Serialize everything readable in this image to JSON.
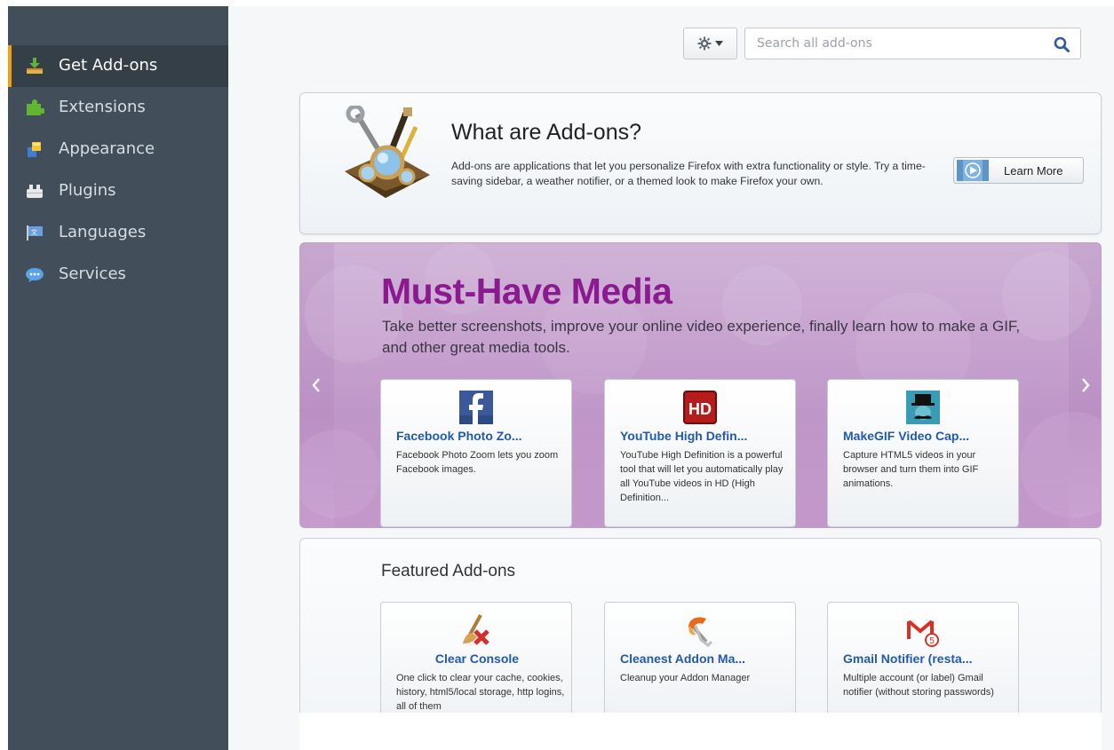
{
  "sidebar": {
    "items": [
      {
        "label": "Get Add-ons",
        "icon": "get-addons-icon",
        "selected": true
      },
      {
        "label": "Extensions",
        "icon": "puzzle-icon",
        "selected": false
      },
      {
        "label": "Appearance",
        "icon": "appearance-icon",
        "selected": false
      },
      {
        "label": "Plugins",
        "icon": "plugin-icon",
        "selected": false
      },
      {
        "label": "Languages",
        "icon": "languages-icon",
        "selected": false
      },
      {
        "label": "Services",
        "icon": "services-icon",
        "selected": false
      }
    ]
  },
  "toolbar": {
    "gear_icon": "gear-icon",
    "search": {
      "placeholder": "Search all add-ons",
      "value": ""
    }
  },
  "about": {
    "title": "What are Add-ons?",
    "description": "Add-ons are applications that let you personalize Firefox with extra functionality or style. Try a time-saving sidebar, a weather notifier, or a themed look to make Firefox your own.",
    "learn_more_label": "Learn More"
  },
  "media": {
    "title": "Must-Have Media",
    "description": "Take better screenshots, improve your online video experience, finally learn how to make a GIF, and other great media tools.",
    "cards": [
      {
        "name": "Facebook Photo Zo...",
        "description": "Facebook Photo Zoom lets you zoom Facebook images.",
        "icon": "facebook-icon"
      },
      {
        "name": "YouTube High Defin...",
        "description": "YouTube High Definition is a powerful tool that will let you automatically play all YouTube videos in HD (High Definition...",
        "icon": "hd-icon"
      },
      {
        "name": "MakeGIF Video Cap...",
        "description": "Capture HTML5 videos in your browser and turn them into GIF animations.",
        "icon": "makegif-icon"
      }
    ]
  },
  "featured": {
    "title": "Featured Add-ons",
    "cards": [
      {
        "name": "Clear Console",
        "description": "One click to clear your cache, cookies, history, html5/local storage, http logins, all of them",
        "icon": "broom-icon"
      },
      {
        "name": "Cleanest Addon Ma...",
        "description": "Cleanup your Addon Manager",
        "icon": "cleanest-addon-icon"
      },
      {
        "name": "Gmail Notifier (resta...",
        "description": "Multiple account (or label) Gmail notifier (without storing passwords)",
        "icon": "gmail-icon",
        "badge": "5"
      }
    ]
  },
  "colors": {
    "sidebar_bg": "#424f5a",
    "sidebar_selected": "#343f48",
    "accent": "#f89c0e",
    "media_title": "#8b1a90",
    "link": "#225aa9"
  }
}
